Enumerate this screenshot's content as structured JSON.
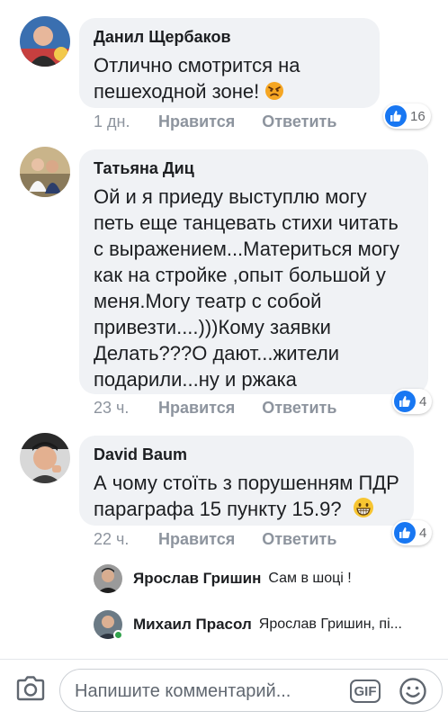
{
  "comments": [
    {
      "author": "Данил Щербаков",
      "lines": [
        "Отлично смотрится на",
        "пешеходной зоне!"
      ],
      "time": "1 дн.",
      "like_label": "Нравится",
      "reply_label": "Ответить",
      "reaction_count": "16"
    },
    {
      "author": "Татьяна Диц",
      "lines": [
        "Ой и я приеду выступлю могу",
        "петь еще танцевать стихи читать",
        "с выражением...Материться могу",
        "как на стройке ,опыт большой у",
        "меня.Могу театр с собой",
        "привезти....)))Кому заявки",
        "Делать???О дают...жители",
        "подарили...ну и ржака"
      ],
      "time": "23 ч.",
      "like_label": "Нравится",
      "reply_label": "Ответить",
      "reaction_count": "4"
    },
    {
      "author": "David Baum",
      "lines": [
        "А чому стоїть з порушенням ПДР",
        "параграфа 15 пункту 15.9?"
      ],
      "time": "22 ч.",
      "like_label": "Нравится",
      "reply_label": "Ответить",
      "reaction_count": "4"
    }
  ],
  "replies": [
    {
      "author": "Ярослав Гришин",
      "text": "Сам в шоці !"
    },
    {
      "author": "Михаил Прасол",
      "text": "Ярослав Гришин, пі..."
    }
  ],
  "composer": {
    "placeholder": "Напишите комментарий...",
    "gif_label": "GIF"
  },
  "colors": {
    "bubble": "#f0f2f5",
    "like_blue": "#1877f2",
    "meta_gray": "#8d949e",
    "online_green": "#31a24c"
  }
}
